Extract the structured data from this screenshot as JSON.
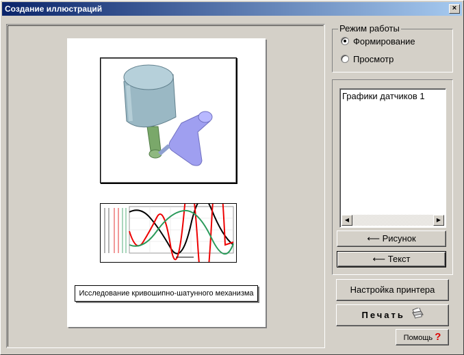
{
  "window": {
    "title": "Создание иллюстраций",
    "close_label": "×"
  },
  "page_preview": {
    "caption": "Исследование кривошипно-шатунного механизма"
  },
  "mode": {
    "legend": "Режим работы",
    "options": [
      {
        "label": "Формирование",
        "checked": true
      },
      {
        "label": "Просмотр",
        "checked": false
      }
    ]
  },
  "list": {
    "items": [
      "Графики датчиков 1"
    ]
  },
  "buttons": {
    "picture": "⟵ Рисунок",
    "text": "⟵ Текст",
    "printer_setup": "Настройка принтера",
    "print": "Печать",
    "help": "Помощь"
  },
  "icons": {
    "close": "close-icon",
    "print": "printer-icon",
    "help": "question-mark-icon"
  }
}
